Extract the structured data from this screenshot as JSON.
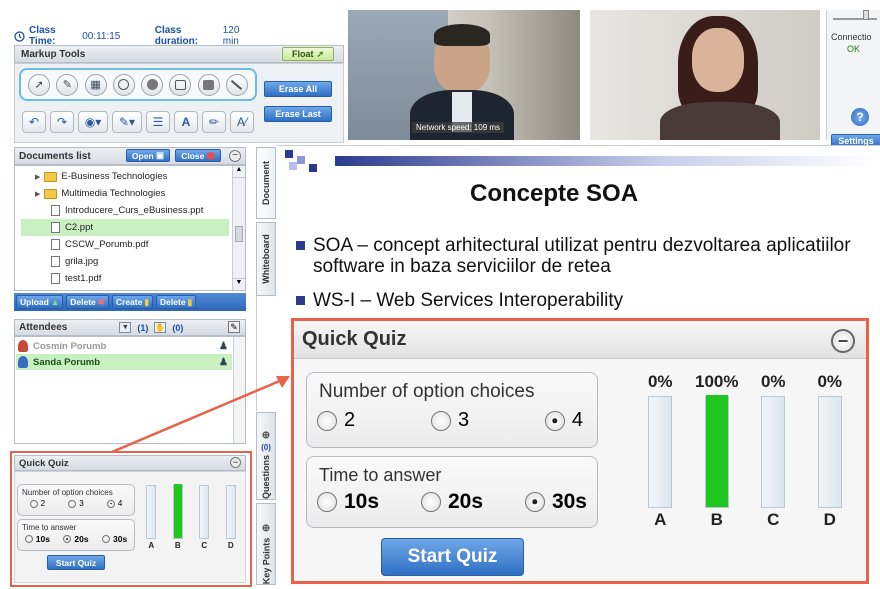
{
  "header": {
    "class_time_label": "Class Time:",
    "class_time_value": "00:11:15",
    "class_duration_label": "Class duration:",
    "class_duration_value": "120 min"
  },
  "markup_tools": {
    "title": "Markup Tools",
    "float_label": "Float",
    "erase_all_label": "Erase All",
    "erase_last_label": "Erase Last"
  },
  "video": {
    "network_speed": "Network speed: 109 ms",
    "connection_label": "Connectio",
    "connection_status": "OK",
    "settings_label": "Settings"
  },
  "documents": {
    "title": "Documents list",
    "open_label": "Open",
    "close_label": "Close",
    "items": [
      {
        "name": "E-Business Technologies",
        "type": "folder"
      },
      {
        "name": "Multimedia Technologies",
        "type": "folder"
      },
      {
        "name": "Introducere_Curs_eBusiness.ppt",
        "type": "file"
      },
      {
        "name": "C2.ppt",
        "type": "file",
        "selected": true
      },
      {
        "name": "CSCW_Porumb.pdf",
        "type": "file"
      },
      {
        "name": "grila.jpg",
        "type": "file"
      },
      {
        "name": "test1.pdf",
        "type": "file"
      }
    ],
    "upload_label": "Upload",
    "delete_label": "Delete",
    "create_label": "Create",
    "delete2_label": "Delete"
  },
  "attendees": {
    "title": "Attendees",
    "count1": "(1)",
    "count2": "(0)",
    "items": [
      {
        "name": "Cosmin Porumb",
        "active": false
      },
      {
        "name": "Sanda Porumb",
        "active": true
      }
    ]
  },
  "side_tabs": {
    "document": "Document",
    "whiteboard": "Whiteboard",
    "questions": "Questions",
    "questions_count": "(0)",
    "key_points": "Key Points"
  },
  "slide": {
    "title": "Concepte SOA",
    "bullets": [
      "SOA – concept arhitectural utilizat pentru dezvoltarea aplicatiilor software in baza serviciilor de retea",
      "WS-I – Web Services Interoperability"
    ]
  },
  "quiz": {
    "title": "Quick Quiz",
    "options_label": "Number of option choices",
    "option_choices": [
      "2",
      "3",
      "4"
    ],
    "selected_option": "4",
    "time_label": "Time to answer",
    "time_choices": [
      "10s",
      "20s",
      "30s"
    ],
    "selected_time_large": "30s",
    "selected_time_small": "20s",
    "start_label": "Start Quiz",
    "bars": [
      {
        "label": "A",
        "percent_text": "0%",
        "value": 0
      },
      {
        "label": "B",
        "percent_text": "100%",
        "value": 100
      },
      {
        "label": "C",
        "percent_text": "0%",
        "value": 0
      },
      {
        "label": "D",
        "percent_text": "0%",
        "value": 0
      }
    ]
  },
  "colors": {
    "accent_blue": "#2f6fc4",
    "highlight_red": "#e8614a",
    "bar_green": "#1fc61f",
    "selected_green": "#c8f0c0"
  }
}
